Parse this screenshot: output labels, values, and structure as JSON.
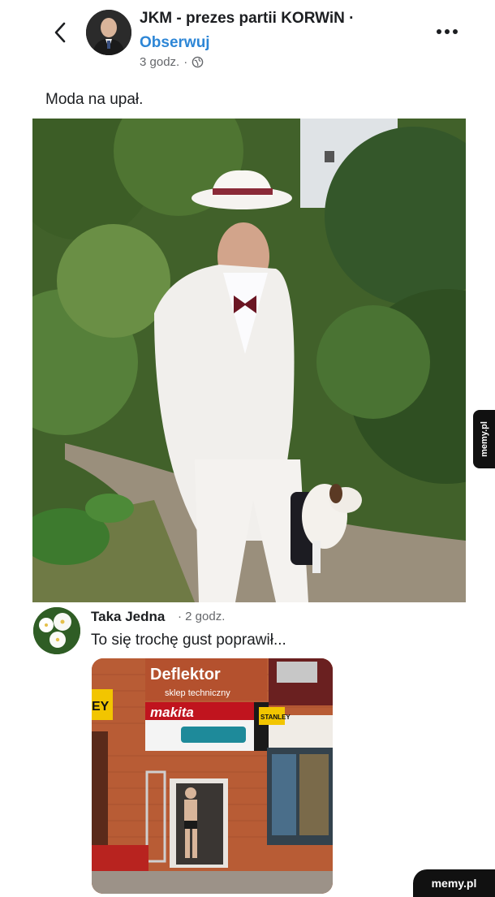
{
  "post": {
    "author": "JKM - prezes partii KORWiN ·",
    "follow_label": "Obserwuj",
    "time": "3 godz.",
    "separator": "·",
    "caption": "Moda na upał."
  },
  "icons": {
    "back": "chevron-left-icon",
    "more": "more-horizontal-icon",
    "audience": "globe-icon"
  },
  "comment": {
    "author": "Taka Jedna",
    "time": "· 2 godz.",
    "text": "To się trochę gust poprawił..."
  },
  "store_photo": {
    "sign_main": "Deflektor",
    "sign_sub": "sklep techniczny",
    "brand_banner": "makita",
    "yellow_sign_left": "EY",
    "yellow_sign_right": "STANLEY"
  },
  "watermark": {
    "side": "memy.pl",
    "bottom": "memy.pl"
  },
  "colors": {
    "link": "#2d86d6",
    "meta": "#65676b",
    "text": "#1c1e21"
  }
}
